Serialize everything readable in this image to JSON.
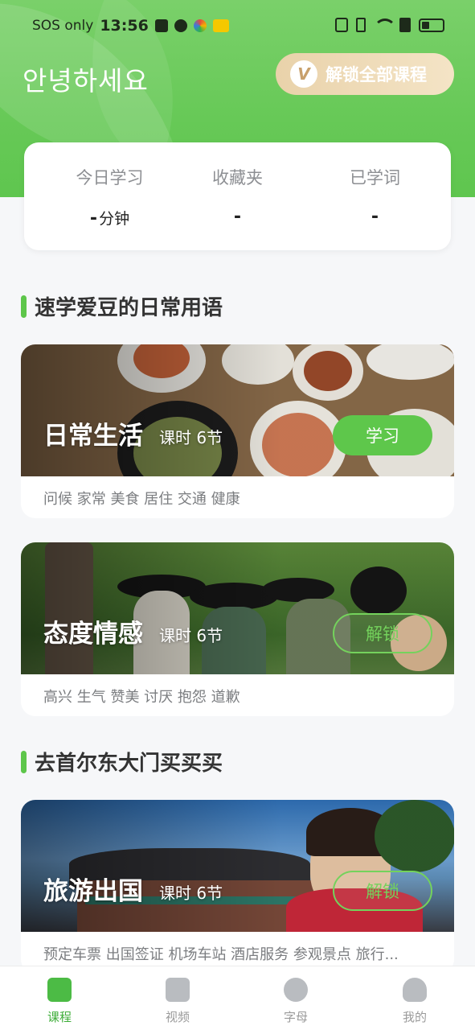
{
  "status_bar": {
    "carrier": "SOS only",
    "time": "13:56"
  },
  "header": {
    "greeting": "안녕하세요",
    "unlock_all_label": "解锁全部课程",
    "vip_glyph": "V"
  },
  "stats": [
    {
      "label": "今日学习",
      "value": "-",
      "unit": "分钟"
    },
    {
      "label": "收藏夹",
      "value": "-",
      "unit": ""
    },
    {
      "label": "已学词",
      "value": "-",
      "unit": ""
    }
  ],
  "sections": [
    {
      "title": "速学爱豆的日常用语",
      "courses": [
        {
          "name": "日常生活",
          "lessons": "课时 6节",
          "button": "学习",
          "tags": "问候 家常 美食 居住 交通 健康"
        },
        {
          "name": "态度情感",
          "lessons": "课时 6节",
          "button": "解锁",
          "tags": "高兴 生气 赞美 讨厌 抱怨 道歉"
        }
      ]
    },
    {
      "title": "去首尔东大门买买买",
      "courses": [
        {
          "name": "旅游出国",
          "lessons": "课时 6节",
          "button": "解锁",
          "tags": "预定车票 出国签证 机场车站 酒店服务 参观景点 旅行..."
        }
      ]
    }
  ],
  "tabbar": [
    {
      "label": "课程",
      "icon": "book-icon",
      "active": true
    },
    {
      "label": "视频",
      "icon": "video-icon",
      "active": false
    },
    {
      "label": "字母",
      "icon": "alphabet-icon",
      "active": false
    },
    {
      "label": "我的",
      "icon": "profile-icon",
      "active": false
    }
  ],
  "colors": {
    "brand_green": "#5ec74b",
    "gold": "#e9d2aa",
    "text_gray": "#7b7d80"
  }
}
